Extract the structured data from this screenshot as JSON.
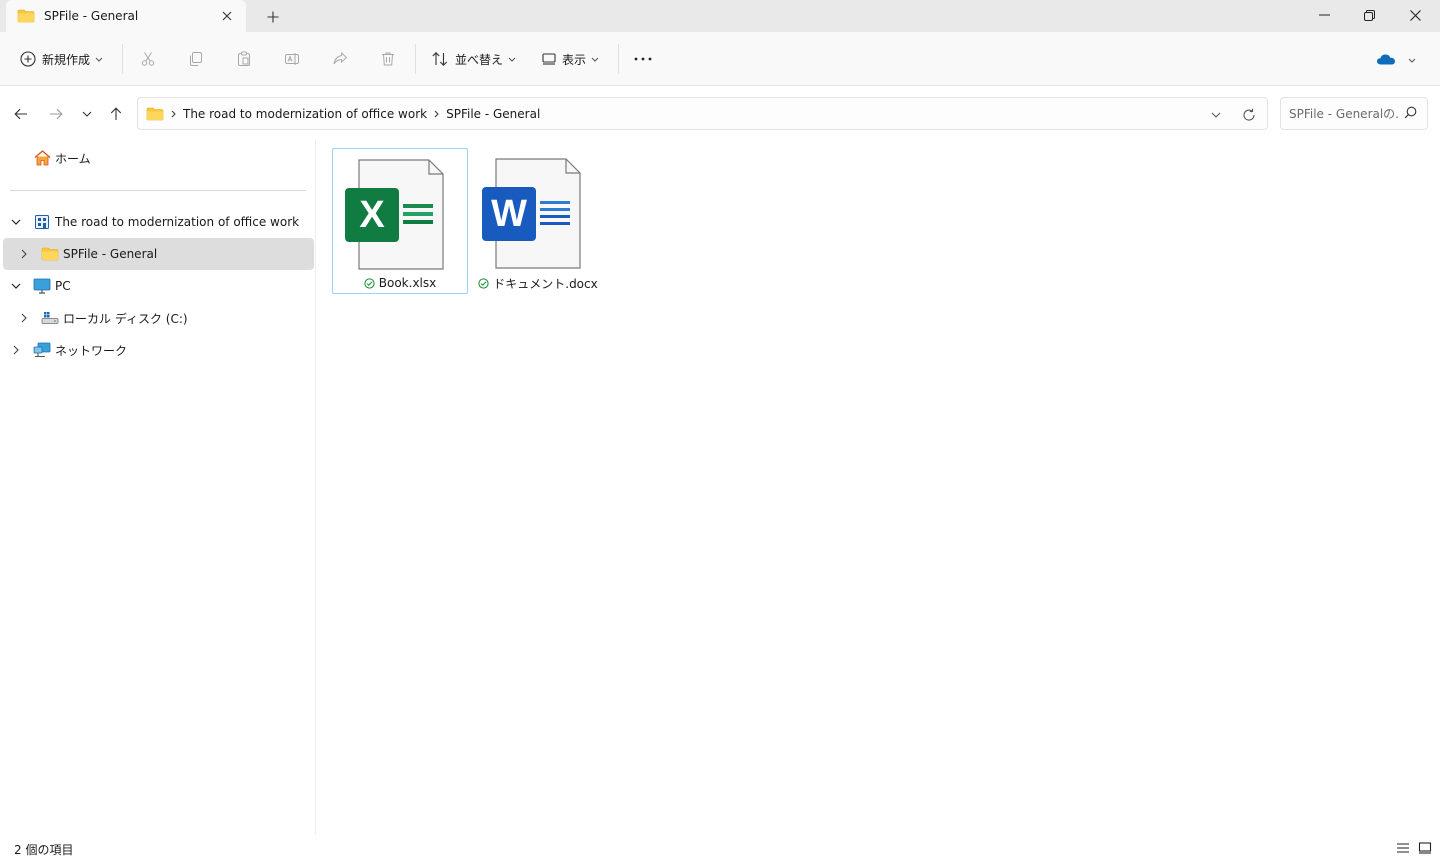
{
  "window": {
    "tab_title": "SPFile - General"
  },
  "toolbar": {
    "new_label": "新規作成",
    "sort_label": "並べ替え",
    "view_label": "表示",
    "more_label": "···"
  },
  "address": {
    "crumbs": [
      "The road to modernization of office work",
      "SPFile - General"
    ],
    "search_placeholder": "SPFile - Generalの..."
  },
  "nav": {
    "home": "ホーム",
    "site": "The road to modernization of office work",
    "spfile": "SPFile - General",
    "pc": "PC",
    "local_disk": "ローカル ディスク (C:)",
    "network": "ネットワーク"
  },
  "files": [
    {
      "name": "Book.xlsx",
      "type": "excel",
      "letter": "X",
      "color": "#107c41"
    },
    {
      "name": "ドキュメント.docx",
      "type": "word",
      "letter": "W",
      "color": "#185abd"
    }
  ],
  "status": {
    "count": "2 個の項目"
  },
  "colors": {
    "folder": "#f8c843",
    "onedrive": "#0f6cbd",
    "sync_ok": "#138a2c"
  }
}
